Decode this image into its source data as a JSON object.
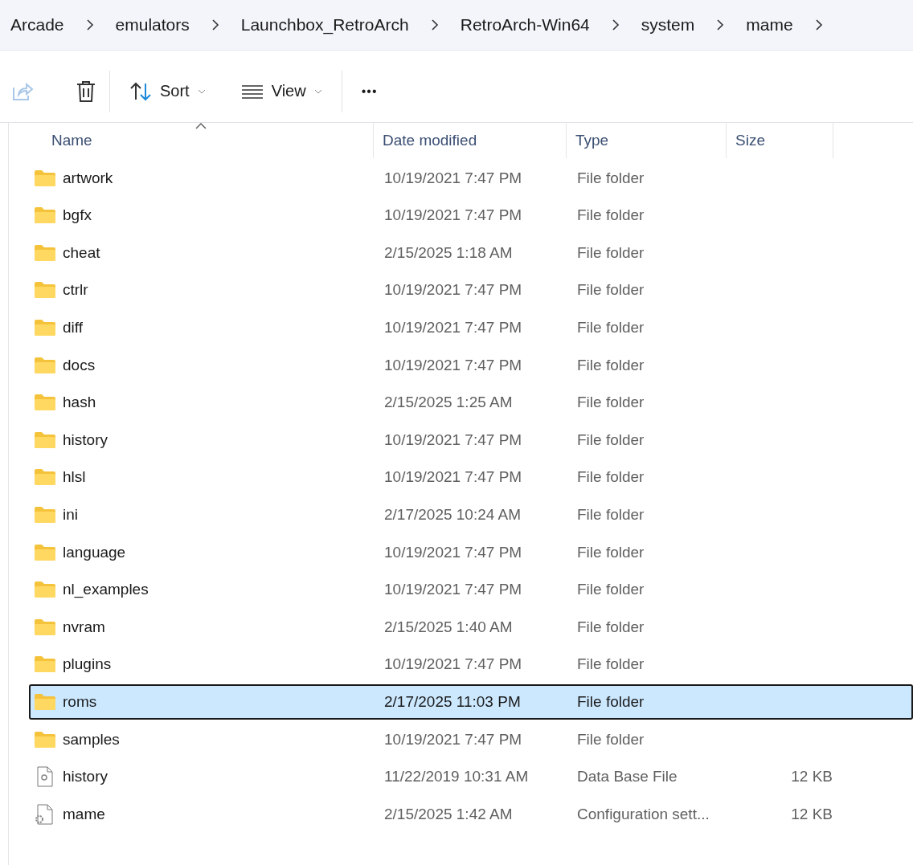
{
  "breadcrumb": [
    "Arcade",
    "emulators",
    "Launchbox_RetroArch",
    "RetroArch-Win64",
    "system",
    "mame"
  ],
  "toolbar": {
    "sort": "Sort",
    "view": "View",
    "more": "•••"
  },
  "columns": [
    {
      "label": "Name",
      "sorted": true
    },
    {
      "label": "Date modified",
      "sorted": false
    },
    {
      "label": "Type",
      "sorted": false
    },
    {
      "label": "Size",
      "sorted": false
    }
  ],
  "rows": [
    {
      "kind": "folder",
      "name": "artwork",
      "date": "10/19/2021 7:47 PM",
      "type": "File folder",
      "selected": false
    },
    {
      "kind": "folder",
      "name": "bgfx",
      "date": "10/19/2021 7:47 PM",
      "type": "File folder",
      "selected": false
    },
    {
      "kind": "folder",
      "name": "cheat",
      "date": "2/15/2025 1:18 AM",
      "type": "File folder",
      "selected": false
    },
    {
      "kind": "folder",
      "name": "ctrlr",
      "date": "10/19/2021 7:47 PM",
      "type": "File folder",
      "selected": false
    },
    {
      "kind": "folder",
      "name": "diff",
      "date": "10/19/2021 7:47 PM",
      "type": "File folder",
      "selected": false
    },
    {
      "kind": "folder",
      "name": "docs",
      "date": "10/19/2021 7:47 PM",
      "type": "File folder",
      "selected": false
    },
    {
      "kind": "folder",
      "name": "hash",
      "date": "2/15/2025 1:25 AM",
      "type": "File folder",
      "selected": false
    },
    {
      "kind": "folder",
      "name": "history",
      "date": "10/19/2021 7:47 PM",
      "type": "File folder",
      "selected": false
    },
    {
      "kind": "folder",
      "name": "hlsl",
      "date": "10/19/2021 7:47 PM",
      "type": "File folder",
      "selected": false
    },
    {
      "kind": "folder",
      "name": "ini",
      "date": "2/17/2025 10:24 AM",
      "type": "File folder",
      "selected": false
    },
    {
      "kind": "folder",
      "name": "language",
      "date": "10/19/2021 7:47 PM",
      "type": "File folder",
      "selected": false
    },
    {
      "kind": "folder",
      "name": "nl_examples",
      "date": "10/19/2021 7:47 PM",
      "type": "File folder",
      "selected": false
    },
    {
      "kind": "folder",
      "name": "nvram",
      "date": "2/15/2025 1:40 AM",
      "type": "File folder",
      "selected": false
    },
    {
      "kind": "folder",
      "name": "plugins",
      "date": "10/19/2021 7:47 PM",
      "type": "File folder",
      "selected": false
    },
    {
      "kind": "folder",
      "name": "roms",
      "date": "2/17/2025 11:03 PM",
      "type": "File folder",
      "selected": true
    },
    {
      "kind": "folder",
      "name": "samples",
      "date": "10/19/2021 7:47 PM",
      "type": "File folder",
      "selected": false
    },
    {
      "kind": "database",
      "name": "history",
      "date": "11/22/2019 10:31 AM",
      "type": "Data Base File",
      "size": "12 KB",
      "selected": false
    },
    {
      "kind": "config",
      "name": "mame",
      "date": "2/15/2025 1:42 AM",
      "type": "Configuration sett...",
      "size": "12 KB",
      "selected": false
    }
  ]
}
